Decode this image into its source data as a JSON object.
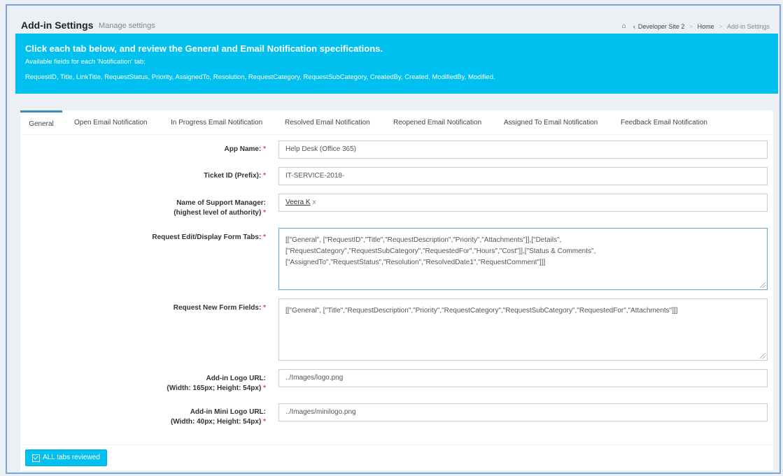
{
  "header": {
    "title": "Add-in Settings",
    "subtitle": "Manage settings",
    "breadcrumb": [
      "Developer Site 2",
      "Home",
      "Add-in Settings"
    ]
  },
  "callout": {
    "heading": "Click each tab below, and review the General and Email Notification specifications.",
    "line1": "Available fields for each 'Notification' tab:",
    "line2": "RequestID, Title, LinkTitle, RequestStatus, Priority, AssignedTo, Resolution, RequestCategory, RequestSubCategory, CreatedBy, Created, ModifiedBy, Modified."
  },
  "tabs": [
    {
      "label": "General",
      "active": true
    },
    {
      "label": "Open Email Notification"
    },
    {
      "label": "In Progress Email Notification"
    },
    {
      "label": "Resolved Email Notification"
    },
    {
      "label": "Reopened Email Notification"
    },
    {
      "label": "Assigned To Email Notification"
    },
    {
      "label": "Feedback Email Notification"
    }
  ],
  "form": {
    "app_name": {
      "label": "App Name:",
      "value": "Help Desk (Office 365)"
    },
    "ticket_id": {
      "label": "Ticket ID (Prefix):",
      "value": "IT-SERVICE-2018-"
    },
    "support_manager": {
      "label1": "Name of Support Manager:",
      "label2": "(highest level of authority)",
      "value": "Veera K",
      "remove": "x"
    },
    "edit_tabs": {
      "label": "Request Edit/Display Form Tabs:",
      "lines": [
        "[[\"General\", [\"RequestID\",\"Title\",\"RequestDescription\",\"Priority\",\"Attachments\"]],[\"Details\",",
        "[\"RequestCategory\",\"RequestSubCategory\",\"RequestedFor\",\"Hours\",\"Cost\"]],[\"Status & Comments\",",
        "[\"AssignedTo\",\"RequestStatus\",\"Resolution\",\"ResolvedDate1\",\"RequestComment\"]]]"
      ]
    },
    "new_fields": {
      "label": "Request New Form Fields:",
      "value": "[[\"General\", [\"Title\",\"RequestDescription\",\"Priority\",\"RequestCategory\",\"RequestSubCategory\",\"RequestedFor\",\"Attachments\"]]]"
    },
    "logo_url": {
      "label1": "Add-in Logo URL:",
      "label2": "(Width: 165px; Height: 54px)",
      "value": "../Images/logo.png"
    },
    "mini_logo_url": {
      "label1": "Add-in Mini Logo URL:",
      "label2": "(Width: 40px; Height: 54px)",
      "value": "../Images/minilogo.png"
    },
    "required_mark": "*"
  },
  "footer": {
    "button_label": "ALL tabs reviewed"
  },
  "icons": {
    "home": "home-icon",
    "back": "chevron-left-icon",
    "check": "check-square-icon"
  },
  "colors": {
    "accent": "#00c0ef",
    "tab_active": "#3c8dbc",
    "required": "#dd4b39"
  }
}
